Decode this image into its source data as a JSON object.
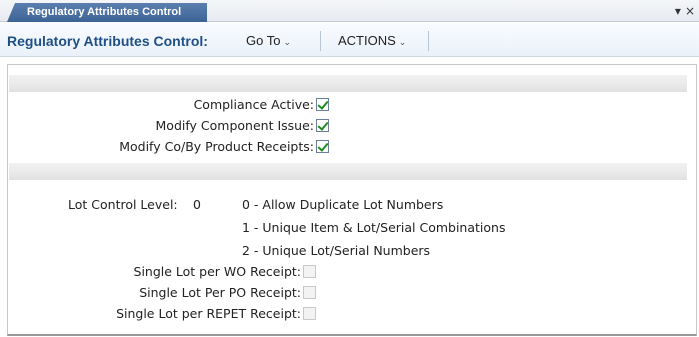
{
  "tab": {
    "label": "Regulatory Attributes Control"
  },
  "tab_controls": {
    "menu_glyph": "▾",
    "close_glyph": "×"
  },
  "header": {
    "title": "Regulatory Attributes Control:",
    "goto_label": "Go To",
    "actions_label": "ACTIONS",
    "caret": "⌄"
  },
  "fields": {
    "compliance_active": {
      "label": "Compliance Active:",
      "checked": true
    },
    "modify_component_issue": {
      "label": "Modify Component Issue:",
      "checked": true
    },
    "modify_coby_receipts": {
      "label": "Modify Co/By Product Receipts:",
      "checked": true
    },
    "lot_control_level": {
      "label": "Lot Control Level:",
      "value": "0",
      "options": [
        "0 - Allow Duplicate Lot Numbers",
        "1 - Unique Item & Lot/Serial Combinations",
        "2 - Unique Lot/Serial Numbers"
      ]
    },
    "single_lot_wo": {
      "label": "Single Lot per WO Receipt:",
      "checked": false
    },
    "single_lot_po": {
      "label": "Single Lot Per PO Receipt:",
      "checked": false
    },
    "single_lot_repet": {
      "label": "Single Lot per REPET Receipt:",
      "checked": false
    }
  },
  "colors": {
    "tab_bg": "#3d6396",
    "title_text": "#1f4f86",
    "check_green": "#1f8a1f"
  }
}
